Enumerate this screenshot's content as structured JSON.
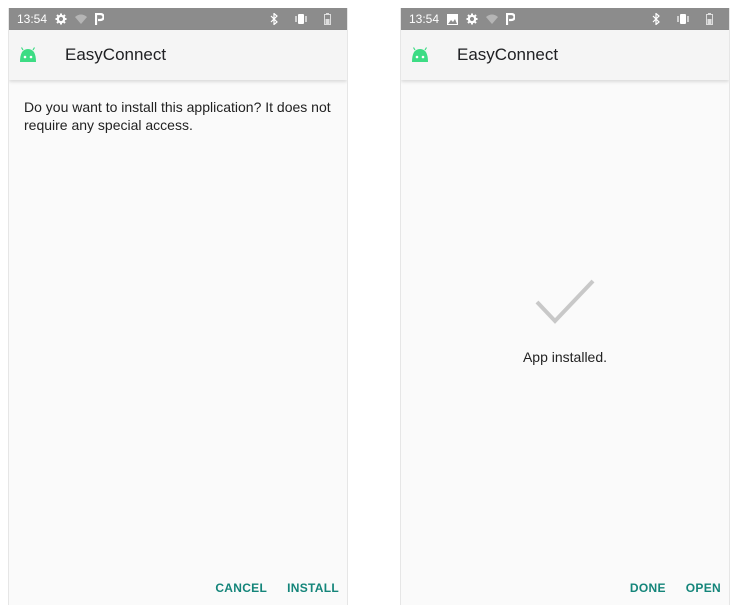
{
  "left_screen": {
    "status_bar": {
      "time": "13:54",
      "left_icons": [
        "gear-icon",
        "wifi-icon",
        "p-icon"
      ],
      "right_icons": [
        "bluetooth-icon",
        "vibrate-icon",
        "battery-icon"
      ]
    },
    "app_bar": {
      "title": "EasyConnect",
      "icon": "android-icon",
      "icon_color": "#3ddc84"
    },
    "message": "Do you want to install this application? It does not require any special access.",
    "buttons": {
      "cancel": "CANCEL",
      "install": "INSTALL"
    }
  },
  "right_screen": {
    "status_bar": {
      "time": "13:54",
      "left_icons": [
        "image-icon",
        "gear-icon",
        "wifi-icon",
        "p-icon"
      ],
      "right_icons": [
        "bluetooth-icon",
        "vibrate-icon",
        "battery-icon"
      ]
    },
    "app_bar": {
      "title": "EasyConnect",
      "icon": "android-icon",
      "icon_color": "#3ddc84"
    },
    "success_icon": "checkmark-icon",
    "message": "App installed.",
    "buttons": {
      "done": "DONE",
      "open": "OPEN"
    }
  },
  "colors": {
    "accent": "#14857a",
    "status_bar": "#8c8c8c",
    "check": "#c8c8c8"
  }
}
